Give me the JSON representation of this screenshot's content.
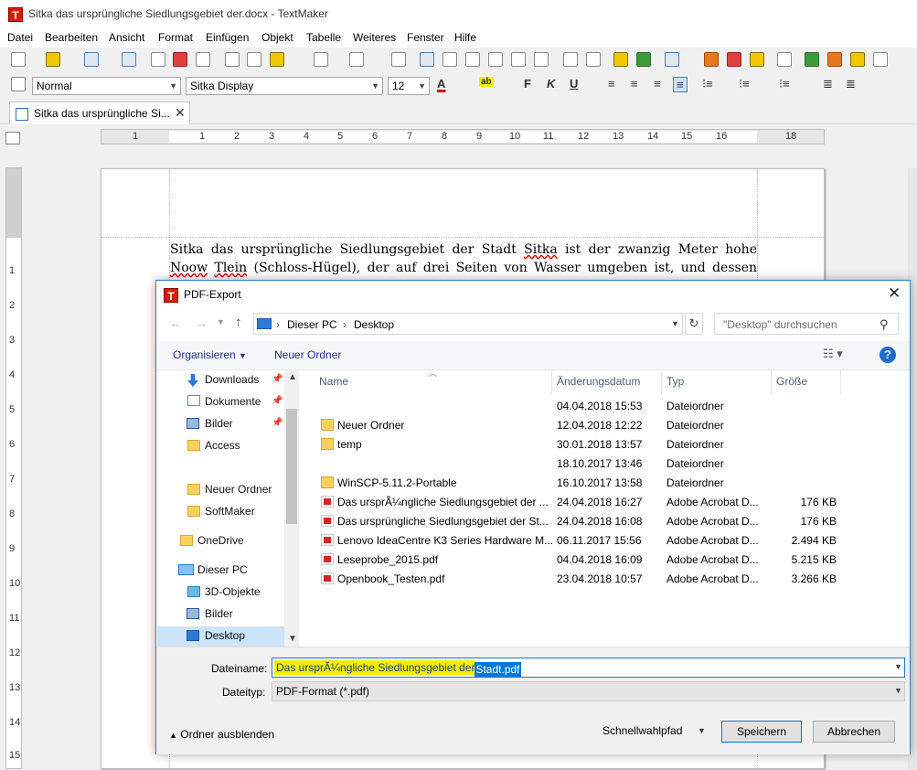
{
  "window": {
    "title": "Sitka das ursprüngliche Siedlungsgebiet der.docx - TextMaker",
    "logo_letter": "T"
  },
  "menu": [
    "Datei",
    "Bearbeiten",
    "Ansicht",
    "Format",
    "Einfügen",
    "Objekt",
    "Tabelle",
    "Weiteres",
    "Fenster",
    "Hilfe"
  ],
  "format_bar": {
    "style": "Normal",
    "font": "Sitka Display",
    "size": "12",
    "font_color": "#d00000",
    "highlight_color": "#f0f000"
  },
  "tab": {
    "label": "Sitka das ursprüngliche Si..."
  },
  "ruler": {
    "numbers": [
      "1",
      "1",
      "2",
      "3",
      "4",
      "5",
      "6",
      "7",
      "8",
      "9",
      "10",
      "11",
      "12",
      "13",
      "14",
      "15",
      "16",
      "18"
    ],
    "v_numbers": [
      "1",
      "2",
      "3",
      "4",
      "5",
      "6",
      "7",
      "8",
      "9",
      "10",
      "11",
      "12",
      "13",
      "14",
      "15"
    ]
  },
  "document": {
    "t1": "Sitka das ursprüngliche Siedlungsgebiet der Stadt ",
    "w1": "Sitka",
    "t2": " ist der zwanzig Meter hohe ",
    "w2": "Noow",
    "t3": " ",
    "w3": "Tlein",
    "t4": " (Schloss-Hügel), der auf drei Seiten von Wasser umgeben ist, und dessen Zugang von Land her durch"
  },
  "dialog": {
    "title": "PDF-Export",
    "address": {
      "pc": "Dieser PC",
      "folder": "Desktop"
    },
    "search_placeholder": "\"Desktop\" durchsuchen",
    "organize": "Organisieren",
    "new_folder": "Neuer Ordner",
    "help": "?",
    "nav_items": [
      {
        "label": "Downloads",
        "pinned": true
      },
      {
        "label": "Dokumente",
        "pinned": true
      },
      {
        "label": "Bilder",
        "pinned": true
      },
      {
        "label": "Access",
        "pinned": false
      },
      {
        "label": "Neuer Ordner",
        "pinned": false
      },
      {
        "label": "SoftMaker",
        "pinned": false
      },
      {
        "label": "OneDrive",
        "pinned": false
      },
      {
        "label": "Dieser PC",
        "pinned": false
      },
      {
        "label": "3D-Objekte",
        "pinned": false
      },
      {
        "label": "Bilder",
        "pinned": false
      },
      {
        "label": "Desktop",
        "pinned": false
      }
    ],
    "columns": [
      "Name",
      "Änderungsdatum",
      "Typ",
      "Größe"
    ],
    "files": [
      {
        "name": "",
        "date": "04.04.2018 15:53",
        "type": "Dateiordner",
        "size": "",
        "icon": "none"
      },
      {
        "name": "Neuer Ordner",
        "date": "12.04.2018 12:22",
        "type": "Dateiordner",
        "size": "",
        "icon": "folder"
      },
      {
        "name": "temp",
        "date": "30.01.2018 13:57",
        "type": "Dateiordner",
        "size": "",
        "icon": "folder"
      },
      {
        "name": "",
        "date": "18.10.2017 13:46",
        "type": "Dateiordner",
        "size": "",
        "icon": "none"
      },
      {
        "name": "WinSCP-5.11.2-Portable",
        "date": "16.10.2017 13:58",
        "type": "Dateiordner",
        "size": "",
        "icon": "folder"
      },
      {
        "name": "Das ursprÃ¼ngliche Siedlungsgebiet der ...",
        "date": "24.04.2018 16:27",
        "type": "Adobe Acrobat D...",
        "size": "176 KB",
        "icon": "pdf"
      },
      {
        "name": "Das ursprüngliche Siedlungsgebiet der St...",
        "date": "24.04.2018 16:08",
        "type": "Adobe Acrobat D...",
        "size": "176 KB",
        "icon": "pdf"
      },
      {
        "name": "Lenovo IdeaCentre K3 Series Hardware M...",
        "date": "06.11.2017 15:56",
        "type": "Adobe Acrobat D...",
        "size": "2.494 KB",
        "icon": "pdf"
      },
      {
        "name": "Leseprobe_2015.pdf",
        "date": "04.04.2018 16:09",
        "type": "Adobe Acrobat D...",
        "size": "5.215 KB",
        "icon": "pdf"
      },
      {
        "name": "Openbook_Testen.pdf",
        "date": "23.04.2018 10:57",
        "type": "Adobe Acrobat D...",
        "size": "3.266 KB",
        "icon": "pdf"
      }
    ],
    "filename_label": "Dateiname:",
    "filename_value_part1": "Das ursprÃ¼ngliche Siedlungsgebiet der ",
    "filename_value_part2": "Stadt.pdf",
    "filetype_label": "Dateityp:",
    "filetype_value": "PDF-Format (*.pdf)",
    "hide_folders": "Ordner ausblenden",
    "quickpath": "Schnellwahlpfad",
    "save": "Speichern",
    "cancel": "Abbrechen"
  }
}
